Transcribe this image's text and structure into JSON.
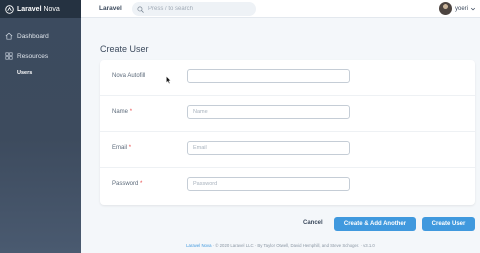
{
  "sidebar": {
    "brand_bold": "Laravel",
    "brand_light": " Nova",
    "items": [
      {
        "label": "Dashboard",
        "icon": "home-icon"
      },
      {
        "label": "Resources",
        "icon": "grid-icon"
      }
    ],
    "sub_item": "Users"
  },
  "header": {
    "app_name": "Laravel",
    "search_placeholder": "Press / to search",
    "user_name": "yoeri"
  },
  "form": {
    "title": "Create User",
    "fields": [
      {
        "label": "Nova Autofill",
        "required": "",
        "value": "",
        "placeholder": ""
      },
      {
        "label": "Name",
        "required": "*",
        "value": "",
        "placeholder": "Name"
      },
      {
        "label": "Email",
        "required": "*",
        "value": "",
        "placeholder": "Email"
      },
      {
        "label": "Password",
        "required": "*",
        "value": "",
        "placeholder": "Password"
      }
    ]
  },
  "actions": {
    "cancel": "Cancel",
    "create_another": "Create & Add Another",
    "create": "Create User"
  },
  "footer": {
    "link": "Laravel Nova",
    "text": " · © 2020 Laravel LLC · By Taylor Otwell, David Hemphill, and Steve Schoger. · v3.1.0"
  },
  "colors": {
    "sidebar": "#3d4b5e",
    "primary": "#4099de",
    "required": "#e74444"
  }
}
